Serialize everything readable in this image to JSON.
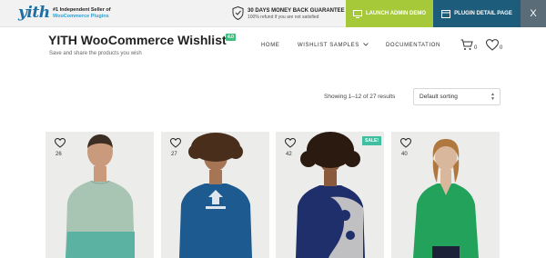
{
  "topbar": {
    "logo": "yith",
    "seller_line1": "#1 Independent Seller of",
    "seller_line2": "WooCommerce Plugins",
    "guarantee_title": "30 DAYS MONEY BACK GUARANTEE",
    "guarantee_sub": "100% refund if you are not satisfied",
    "launch_label": "LAUNCH ADMIN DEMO",
    "plugin_label": "PLUGIN DETAIL PAGE",
    "close_label": "X"
  },
  "header": {
    "title": "YITH WooCommerce Wishlist",
    "version_badge": "4.0",
    "tagline": "Save and share the products you wish",
    "nav": {
      "home": "HOME",
      "samples": "WISHLIST SAMPLES",
      "documentation": "DOCUMENTATION"
    },
    "cart_count": "0",
    "wishlist_count": "0"
  },
  "toolbar": {
    "showing": "Showing 1–12 of 27 results",
    "sort_value": "Default sorting"
  },
  "products": [
    {
      "wishlist_count": "26",
      "sale": ""
    },
    {
      "wishlist_count": "27",
      "sale": ""
    },
    {
      "wishlist_count": "42",
      "sale": "SALE!"
    },
    {
      "wishlist_count": "40",
      "sale": ""
    }
  ],
  "colors": {
    "launch": "#a6c93a",
    "plugin": "#1e5c7c",
    "close": "#5a6c78",
    "accent_badge": "#3fbf9f"
  }
}
